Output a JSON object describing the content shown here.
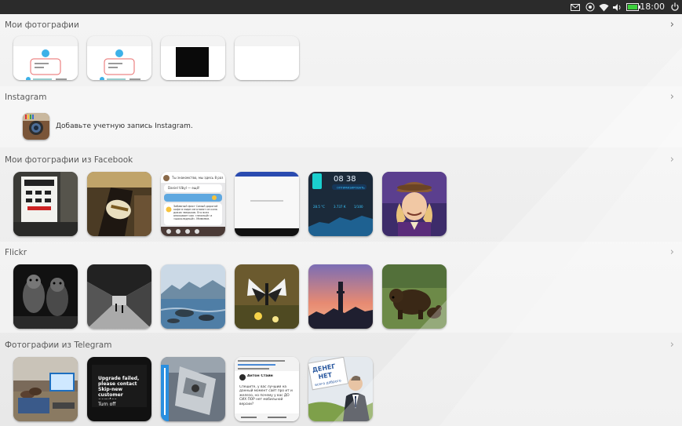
{
  "status_bar": {
    "time": "18:00",
    "icons": [
      "mail-icon",
      "location-icon",
      "wifi-icon",
      "volume-icon",
      "battery-icon",
      "power-icon"
    ]
  },
  "sections": [
    {
      "title": "Мои фотографии"
    },
    {
      "title": "Instagram",
      "prompt": "Добавьте учетную запись Instagram."
    },
    {
      "title": "Мои фотографии из Facebook"
    },
    {
      "title": "Flickr"
    },
    {
      "title": "Фотографии из Telegram"
    }
  ],
  "facebook_tile3": {
    "line1": "Ты знакомство, мы здесь 8 раз",
    "line2": "Daniel Vibyl — ещё!",
    "fact": "Забавный факт Самый дорогой кофе в мире изготовят из кала диких зверьков. Его всех описывает как «нежный» и «шоколадный». Мммммм."
  },
  "facebook_tile5": {
    "time": "08 38",
    "button": "ОПТИМИЗИРОВАТЬ",
    "stat1": "28.5 °C",
    "stat2": "3.737 К",
    "stat3": "1/100"
  },
  "telegram_tile2": {
    "text": "Upgrade failed, please contact Skip-new customer service.",
    "button": "Turn off"
  },
  "telegram_tile4": {
    "header": "Антон Стайн",
    "body": "Спешите, у вас лучший на данный момент сайт про ит и железо, но почему у вас ДО СИХ ПОР нет мобильной версии?"
  },
  "telegram_tile5": {
    "sign_line1": "ДЕНЕГ",
    "sign_line2": "НЕТ",
    "sign_line3": "всего доброго"
  }
}
